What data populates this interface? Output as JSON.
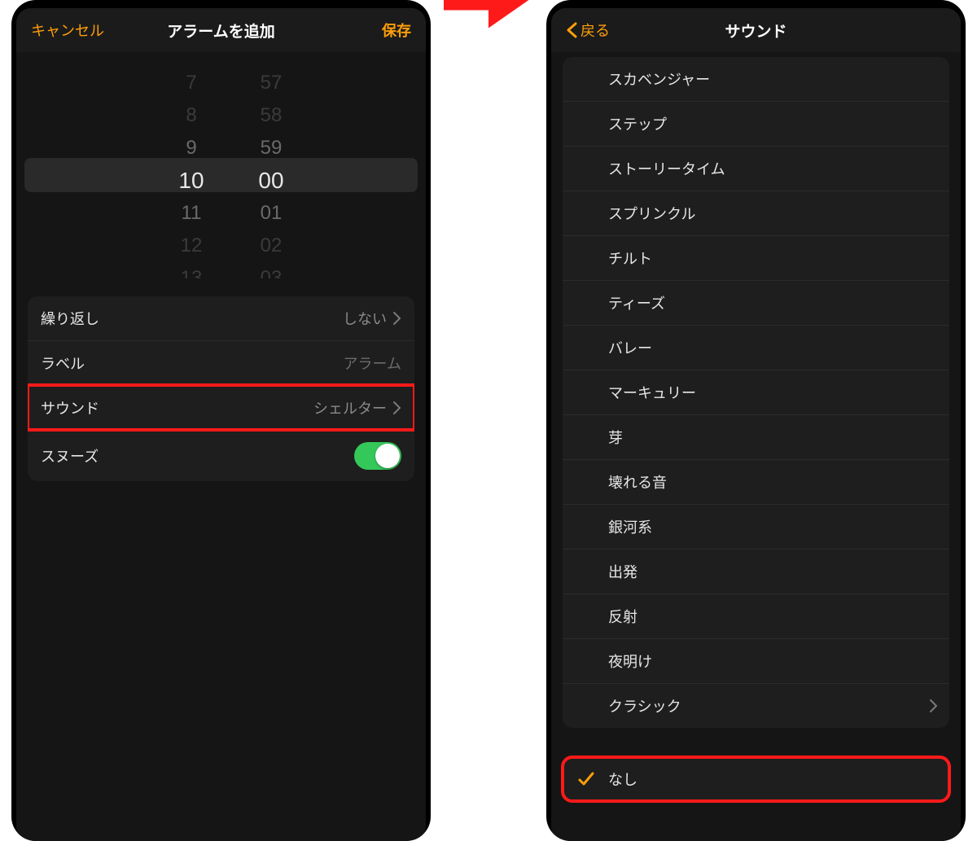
{
  "colors": {
    "accent": "#ff9f0a",
    "toggle_on": "#34c759",
    "highlight": "#ff1a1a"
  },
  "left": {
    "cancel": "キャンセル",
    "title": "アラームを追加",
    "save": "保存",
    "picker": {
      "hours": [
        "7",
        "8",
        "9",
        "10",
        "11",
        "12",
        "13"
      ],
      "minutes": [
        "57",
        "58",
        "59",
        "00",
        "01",
        "02",
        "03"
      ]
    },
    "rows": {
      "repeat": {
        "label": "繰り返し",
        "value": "しない"
      },
      "label": {
        "label": "ラベル",
        "value": "アラーム"
      },
      "sound": {
        "label": "サウンド",
        "value": "シェルター"
      },
      "snooze": {
        "label": "スヌーズ",
        "on": true
      }
    }
  },
  "right": {
    "back": "戻る",
    "title": "サウンド",
    "sounds": [
      "スカベンジャー",
      "ステップ",
      "ストーリータイム",
      "スプリンクル",
      "チルト",
      "ティーズ",
      "バレー",
      "マーキュリー",
      "芽",
      "壊れる音",
      "銀河系",
      "出発",
      "反射",
      "夜明け"
    ],
    "classic": "クラシック",
    "none": "なし"
  }
}
